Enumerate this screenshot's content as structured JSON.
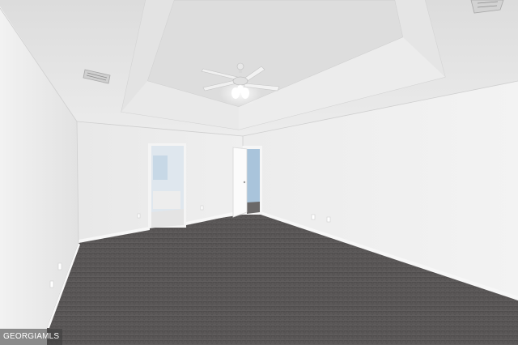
{
  "photo": {
    "subject": "empty-bedroom-with-tray-ceiling",
    "watermark": {
      "text": "GEORGIAMLS",
      "color": "#ffffff"
    },
    "colors": {
      "ceiling": "#e4e4e4",
      "tray_inner": "#dedede",
      "walls": "#ededed",
      "carpet": "#5b5858",
      "trim": "#f6f6f6",
      "doorway_blue": "#a9c4db"
    },
    "icons": [
      "ceiling-fan-icon",
      "air-vent-icon"
    ]
  }
}
